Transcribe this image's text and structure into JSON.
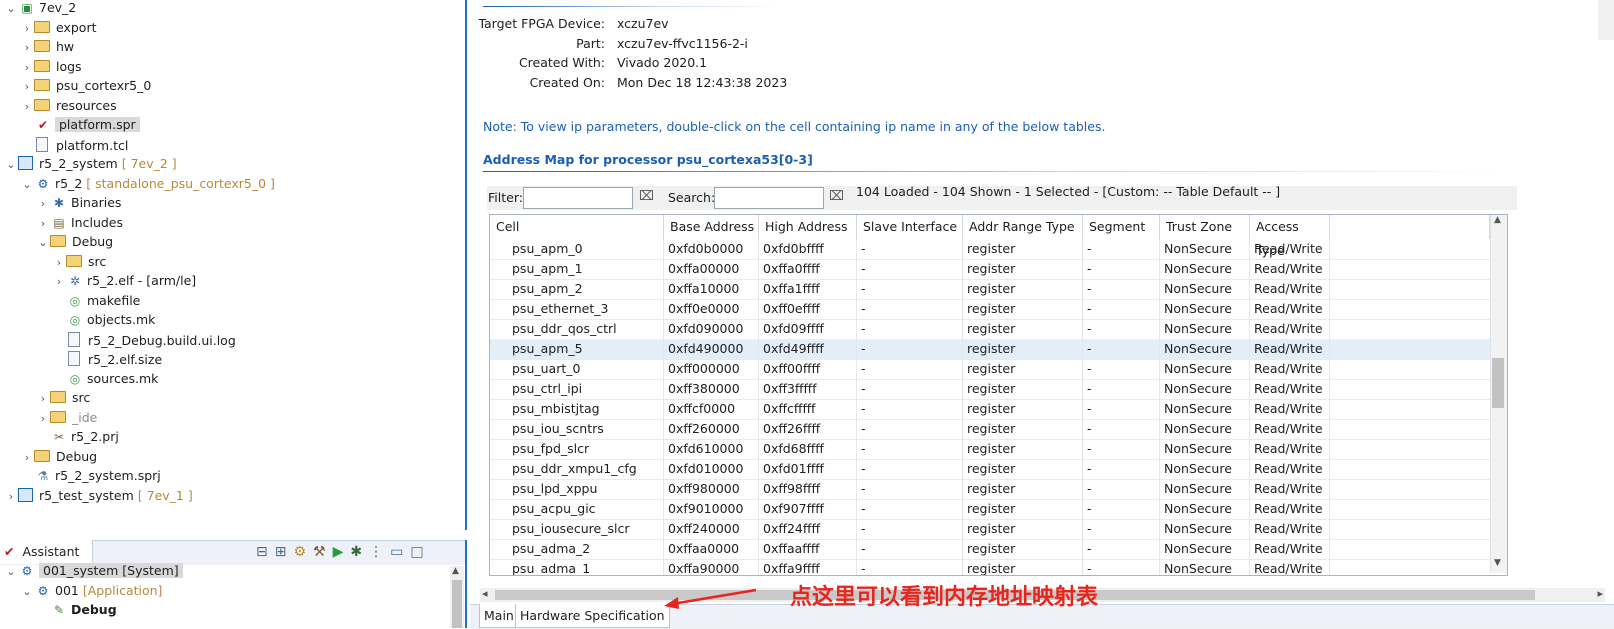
{
  "explorer": {
    "items": [
      {
        "label": "7ev_2",
        "deco": "",
        "indent": 0,
        "chev": "v",
        "icon": "platform"
      },
      {
        "label": "export",
        "deco": "",
        "indent": 1,
        "chev": ">",
        "icon": "folder"
      },
      {
        "label": "hw",
        "deco": "",
        "indent": 1,
        "chev": ">",
        "icon": "folder"
      },
      {
        "label": "logs",
        "deco": "",
        "indent": 1,
        "chev": ">",
        "icon": "folder"
      },
      {
        "label": "psu_cortexr5_0",
        "deco": "",
        "indent": 1,
        "chev": ">",
        "icon": "folder"
      },
      {
        "label": "resources",
        "deco": "",
        "indent": 1,
        "chev": ">",
        "icon": "folder"
      },
      {
        "label": "platform.spr",
        "deco": "",
        "indent": 1,
        "chev": "",
        "icon": "spr",
        "selected": true
      },
      {
        "label": "platform.tcl",
        "deco": "",
        "indent": 1,
        "chev": "",
        "icon": "file"
      },
      {
        "label": "r5_2_system",
        "deco": "[ 7ev_2 ]",
        "indent": 0,
        "chev": "v",
        "icon": "system"
      },
      {
        "label": "r5_2",
        "deco": "[ standalone_psu_cortexr5_0 ]",
        "indent": 1,
        "chev": "v",
        "icon": "app"
      },
      {
        "label": "Binaries",
        "deco": "",
        "indent": 2,
        "chev": ">",
        "icon": "binaries"
      },
      {
        "label": "Includes",
        "deco": "",
        "indent": 2,
        "chev": ">",
        "icon": "includes"
      },
      {
        "label": "Debug",
        "deco": "",
        "indent": 2,
        "chev": "v",
        "icon": "folder"
      },
      {
        "label": "src",
        "deco": "",
        "indent": 3,
        "chev": ">",
        "icon": "folder"
      },
      {
        "label": "r5_2.elf - [arm/le]",
        "deco": "",
        "indent": 3,
        "chev": ">",
        "icon": "elf"
      },
      {
        "label": "makefile",
        "deco": "",
        "indent": 3,
        "chev": "",
        "icon": "mk"
      },
      {
        "label": "objects.mk",
        "deco": "",
        "indent": 3,
        "chev": "",
        "icon": "mk"
      },
      {
        "label": "r5_2_Debug.build.ui.log",
        "deco": "",
        "indent": 3,
        "chev": "",
        "icon": "file"
      },
      {
        "label": "r5_2.elf.size",
        "deco": "",
        "indent": 3,
        "chev": "",
        "icon": "file"
      },
      {
        "label": "sources.mk",
        "deco": "",
        "indent": 3,
        "chev": "",
        "icon": "mk"
      },
      {
        "label": "src",
        "deco": "",
        "indent": 2,
        "chev": ">",
        "icon": "folder"
      },
      {
        "label": "_ide",
        "deco": "",
        "indent": 2,
        "chev": ">",
        "icon": "folder",
        "muted": true
      },
      {
        "label": "r5_2.prj",
        "deco": "",
        "indent": 2,
        "chev": "",
        "icon": "prj"
      },
      {
        "label": "Debug",
        "deco": "",
        "indent": 1,
        "chev": ">",
        "icon": "folder"
      },
      {
        "label": "r5_2_system.sprj",
        "deco": "",
        "indent": 1,
        "chev": "",
        "icon": "sprj"
      },
      {
        "label": "r5_test_system",
        "deco": "[ 7ev_1 ]",
        "indent": 0,
        "chev": ">",
        "icon": "system"
      }
    ]
  },
  "assistant": {
    "tab_label": "Assistant",
    "items": [
      {
        "label": "001_system [System]",
        "deco": "",
        "indent": 0,
        "chev": "v",
        "selected": true
      },
      {
        "label": "001",
        "deco": "[Application]",
        "indent": 1,
        "chev": "v"
      },
      {
        "label": "Debug",
        "deco": "",
        "indent": 2,
        "chev": "",
        "bold": true
      }
    ]
  },
  "design": {
    "fields": [
      {
        "label": "Target FPGA Device:",
        "value": "xczu7ev"
      },
      {
        "label": "Part:",
        "value": "xczu7ev-ffvc1156-2-i"
      },
      {
        "label": "Created With:",
        "value": "Vivado 2020.1"
      },
      {
        "label": "Created On:",
        "value": "Mon Dec 18 12:43:38 2023"
      }
    ],
    "note": "Note: To view ip parameters, double-click on the cell containing ip name in any of the below tables."
  },
  "addrmap": {
    "title": "Address Map for processor psu_cortexa53[0-3]",
    "filter_label": "Filter:",
    "search_label": "Search:",
    "status": "104 Loaded - 104 Shown - 1 Selected -  [Custom: -- Table Default -- ]",
    "columns": [
      "Cell",
      "Base Address",
      "High Address",
      "Slave Interface",
      "Addr Range Type",
      "Segment",
      "Trust Zone",
      "Access Type"
    ],
    "rows": [
      [
        "psu_apm_0",
        "0xfd0b0000",
        "0xfd0bffff",
        "-",
        "register",
        "-",
        "NonSecure",
        "Read/Write"
      ],
      [
        "psu_apm_1",
        "0xffa00000",
        "0xffa0ffff",
        "-",
        "register",
        "-",
        "NonSecure",
        "Read/Write"
      ],
      [
        "psu_apm_2",
        "0xffa10000",
        "0xffa1ffff",
        "-",
        "register",
        "-",
        "NonSecure",
        "Read/Write"
      ],
      [
        "psu_ethernet_3",
        "0xff0e0000",
        "0xff0effff",
        "-",
        "register",
        "-",
        "NonSecure",
        "Read/Write"
      ],
      [
        "psu_ddr_qos_ctrl",
        "0xfd090000",
        "0xfd09ffff",
        "-",
        "register",
        "-",
        "NonSecure",
        "Read/Write"
      ],
      [
        "psu_apm_5",
        "0xfd490000",
        "0xfd49ffff",
        "-",
        "register",
        "-",
        "NonSecure",
        "Read/Write"
      ],
      [
        "psu_uart_0",
        "0xff000000",
        "0xff00ffff",
        "-",
        "register",
        "-",
        "NonSecure",
        "Read/Write"
      ],
      [
        "psu_ctrl_ipi",
        "0xff380000",
        "0xff3fffff",
        "-",
        "register",
        "-",
        "NonSecure",
        "Read/Write"
      ],
      [
        "psu_mbistjtag",
        "0xffcf0000",
        "0xffcfffff",
        "-",
        "register",
        "-",
        "NonSecure",
        "Read/Write"
      ],
      [
        "psu_iou_scntrs",
        "0xff260000",
        "0xff26ffff",
        "-",
        "register",
        "-",
        "NonSecure",
        "Read/Write"
      ],
      [
        "psu_fpd_slcr",
        "0xfd610000",
        "0xfd68ffff",
        "-",
        "register",
        "-",
        "NonSecure",
        "Read/Write"
      ],
      [
        "psu_ddr_xmpu1_cfg",
        "0xfd010000",
        "0xfd01ffff",
        "-",
        "register",
        "-",
        "NonSecure",
        "Read/Write"
      ],
      [
        "psu_lpd_xppu",
        "0xff980000",
        "0xff98ffff",
        "-",
        "register",
        "-",
        "NonSecure",
        "Read/Write"
      ],
      [
        "psu_acpu_gic",
        "0xf9010000",
        "0xf907ffff",
        "-",
        "register",
        "-",
        "NonSecure",
        "Read/Write"
      ],
      [
        "psu_iousecure_slcr",
        "0xff240000",
        "0xff24ffff",
        "-",
        "register",
        "-",
        "NonSecure",
        "Read/Write"
      ],
      [
        "psu_adma_2",
        "0xffaa0000",
        "0xffaaffff",
        "-",
        "register",
        "-",
        "NonSecure",
        "Read/Write"
      ],
      [
        "psu_adma_1",
        "0xffa90000",
        "0xffa9ffff",
        "-",
        "register",
        "-",
        "NonSecure",
        "Read/Write"
      ]
    ],
    "highlight_row": 5
  },
  "bottom_tabs": [
    "Main",
    "Hardware Specification"
  ],
  "annotation": "点这里可以看到内存地址映射表",
  "colors": {
    "accent": "#1a5fb4",
    "annotation": "#e8241c",
    "highlight": "#e3eef9"
  }
}
